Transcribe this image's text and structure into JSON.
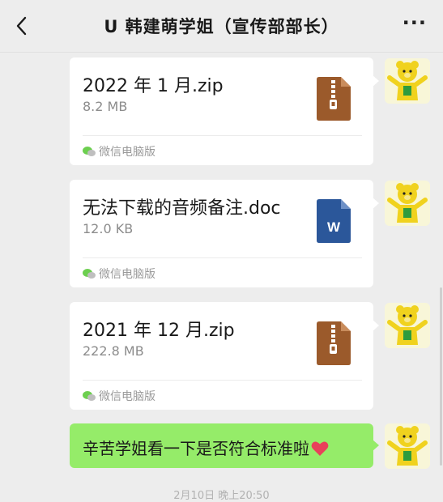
{
  "header": {
    "title": "U 韩建萌学姐（宣传部部长）",
    "more": "···"
  },
  "messages": [
    {
      "type": "file",
      "name": "2022 年 1 月.zip",
      "size": "8.2 MB",
      "source": "微信电脑版",
      "icon": "zip-icon"
    },
    {
      "type": "file",
      "name": "无法下载的音频备注.doc",
      "size": "12.0 KB",
      "source": "微信电脑版",
      "icon": "word-doc-icon",
      "icon_letter": "W"
    },
    {
      "type": "file",
      "name": "2021 年 12 月.zip",
      "size": "222.8 MB",
      "source": "微信电脑版",
      "icon": "zip-icon"
    },
    {
      "type": "text",
      "text": "辛苦学姐看一下是否符合标准啦",
      "emoji": "heart-icon"
    }
  ],
  "timestamp": "2月10日 晚上20:50",
  "colors": {
    "bubble_green": "#95ec69",
    "background": "#ededed",
    "zip_brown": "#9b5a2b",
    "word_blue": "#2b579a"
  }
}
